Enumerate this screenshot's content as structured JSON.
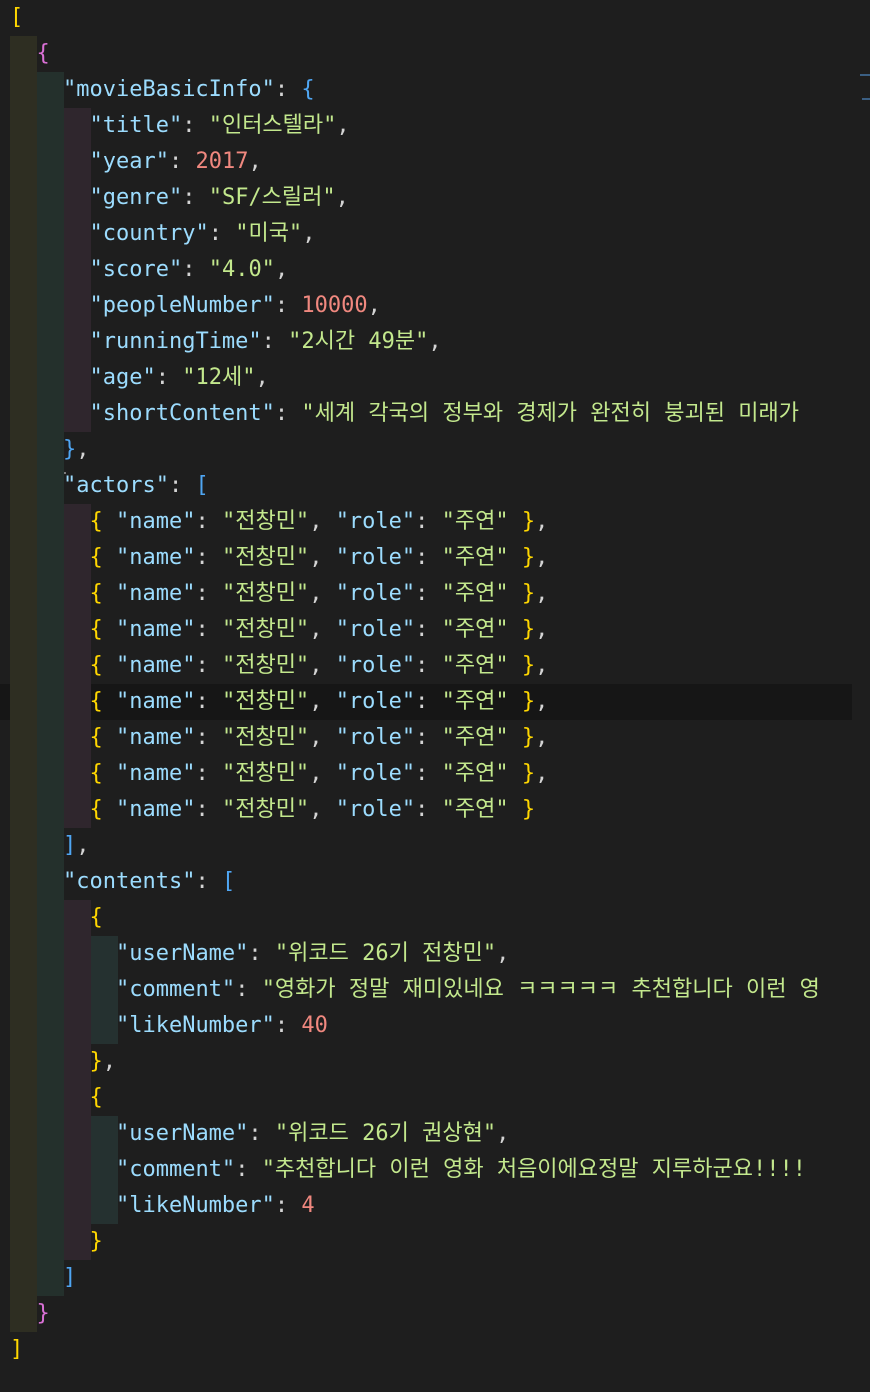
{
  "editor": {
    "language": "json",
    "lines": [
      {
        "tokens": [
          {
            "t": "[",
            "c": "b1"
          }
        ]
      },
      {
        "tokens": [
          {
            "t": "  ",
            "c": "p"
          },
          {
            "t": "{",
            "c": "b2"
          }
        ]
      },
      {
        "tokens": [
          {
            "t": "    ",
            "c": "p"
          },
          {
            "t": "\"movieBasicInfo\"",
            "c": "kk"
          },
          {
            "t": ": ",
            "c": "p"
          },
          {
            "t": "{",
            "c": "b3"
          }
        ]
      },
      {
        "tokens": [
          {
            "t": "      ",
            "c": "p"
          },
          {
            "t": "\"title\"",
            "c": "kk"
          },
          {
            "t": ": ",
            "c": "p"
          },
          {
            "t": "\"인터스텔라\"",
            "c": "ks"
          },
          {
            "t": ",",
            "c": "p"
          }
        ]
      },
      {
        "tokens": [
          {
            "t": "      ",
            "c": "p"
          },
          {
            "t": "\"year\"",
            "c": "kk"
          },
          {
            "t": ": ",
            "c": "p"
          },
          {
            "t": "2017",
            "c": "n"
          },
          {
            "t": ",",
            "c": "p"
          }
        ]
      },
      {
        "tokens": [
          {
            "t": "      ",
            "c": "p"
          },
          {
            "t": "\"genre\"",
            "c": "kk"
          },
          {
            "t": ": ",
            "c": "p"
          },
          {
            "t": "\"SF/스릴러\"",
            "c": "ks"
          },
          {
            "t": ",",
            "c": "p"
          }
        ]
      },
      {
        "tokens": [
          {
            "t": "      ",
            "c": "p"
          },
          {
            "t": "\"country\"",
            "c": "kk"
          },
          {
            "t": ": ",
            "c": "p"
          },
          {
            "t": "\"미국\"",
            "c": "ks"
          },
          {
            "t": ",",
            "c": "p"
          }
        ]
      },
      {
        "tokens": [
          {
            "t": "      ",
            "c": "p"
          },
          {
            "t": "\"score\"",
            "c": "kk"
          },
          {
            "t": ": ",
            "c": "p"
          },
          {
            "t": "\"4.0\"",
            "c": "ks"
          },
          {
            "t": ",",
            "c": "p"
          }
        ]
      },
      {
        "tokens": [
          {
            "t": "      ",
            "c": "p"
          },
          {
            "t": "\"peopleNumber\"",
            "c": "kk"
          },
          {
            "t": ": ",
            "c": "p"
          },
          {
            "t": "10000",
            "c": "n"
          },
          {
            "t": ",",
            "c": "p"
          }
        ]
      },
      {
        "tokens": [
          {
            "t": "      ",
            "c": "p"
          },
          {
            "t": "\"runningTime\"",
            "c": "kk"
          },
          {
            "t": ": ",
            "c": "p"
          },
          {
            "t": "\"2시간 49분\"",
            "c": "ks"
          },
          {
            "t": ",",
            "c": "p"
          }
        ]
      },
      {
        "tokens": [
          {
            "t": "      ",
            "c": "p"
          },
          {
            "t": "\"age\"",
            "c": "kk"
          },
          {
            "t": ": ",
            "c": "p"
          },
          {
            "t": "\"12세\"",
            "c": "ks"
          },
          {
            "t": ",",
            "c": "p"
          }
        ]
      },
      {
        "tokens": [
          {
            "t": "      ",
            "c": "p"
          },
          {
            "t": "\"shortContent\"",
            "c": "kk"
          },
          {
            "t": ": ",
            "c": "p"
          },
          {
            "t": "\"세계 각국의 정부와 경제가 완전히 붕괴된 미래가",
            "c": "ks"
          }
        ]
      },
      {
        "tokens": [
          {
            "t": "    ",
            "c": "p"
          },
          {
            "t": "}",
            "c": "b3"
          },
          {
            "t": ",",
            "c": "p"
          }
        ]
      },
      {
        "tokens": [
          {
            "t": "    ",
            "c": "p"
          },
          {
            "t": "\"actors\"",
            "c": "kk"
          },
          {
            "t": ": ",
            "c": "p"
          },
          {
            "t": "[",
            "c": "b3"
          }
        ]
      },
      {
        "tokens": [
          {
            "t": "      ",
            "c": "p"
          },
          {
            "t": "{",
            "c": "b1"
          },
          {
            "t": " ",
            "c": "p"
          },
          {
            "t": "\"name\"",
            "c": "kk"
          },
          {
            "t": ": ",
            "c": "p"
          },
          {
            "t": "\"전창민\"",
            "c": "ks"
          },
          {
            "t": ", ",
            "c": "p"
          },
          {
            "t": "\"role\"",
            "c": "kk"
          },
          {
            "t": ": ",
            "c": "p"
          },
          {
            "t": "\"주연\"",
            "c": "ks"
          },
          {
            "t": " ",
            "c": "p"
          },
          {
            "t": "}",
            "c": "b1"
          },
          {
            "t": ",",
            "c": "p"
          }
        ]
      },
      {
        "tokens": [
          {
            "t": "      ",
            "c": "p"
          },
          {
            "t": "{",
            "c": "b1"
          },
          {
            "t": " ",
            "c": "p"
          },
          {
            "t": "\"name\"",
            "c": "kk"
          },
          {
            "t": ": ",
            "c": "p"
          },
          {
            "t": "\"전창민\"",
            "c": "ks"
          },
          {
            "t": ", ",
            "c": "p"
          },
          {
            "t": "\"role\"",
            "c": "kk"
          },
          {
            "t": ": ",
            "c": "p"
          },
          {
            "t": "\"주연\"",
            "c": "ks"
          },
          {
            "t": " ",
            "c": "p"
          },
          {
            "t": "}",
            "c": "b1"
          },
          {
            "t": ",",
            "c": "p"
          }
        ]
      },
      {
        "tokens": [
          {
            "t": "      ",
            "c": "p"
          },
          {
            "t": "{",
            "c": "b1"
          },
          {
            "t": " ",
            "c": "p"
          },
          {
            "t": "\"name\"",
            "c": "kk"
          },
          {
            "t": ": ",
            "c": "p"
          },
          {
            "t": "\"전창민\"",
            "c": "ks"
          },
          {
            "t": ", ",
            "c": "p"
          },
          {
            "t": "\"role\"",
            "c": "kk"
          },
          {
            "t": ": ",
            "c": "p"
          },
          {
            "t": "\"주연\"",
            "c": "ks"
          },
          {
            "t": " ",
            "c": "p"
          },
          {
            "t": "}",
            "c": "b1"
          },
          {
            "t": ",",
            "c": "p"
          }
        ]
      },
      {
        "tokens": [
          {
            "t": "      ",
            "c": "p"
          },
          {
            "t": "{",
            "c": "b1"
          },
          {
            "t": " ",
            "c": "p"
          },
          {
            "t": "\"name\"",
            "c": "kk"
          },
          {
            "t": ": ",
            "c": "p"
          },
          {
            "t": "\"전창민\"",
            "c": "ks"
          },
          {
            "t": ", ",
            "c": "p"
          },
          {
            "t": "\"role\"",
            "c": "kk"
          },
          {
            "t": ": ",
            "c": "p"
          },
          {
            "t": "\"주연\"",
            "c": "ks"
          },
          {
            "t": " ",
            "c": "p"
          },
          {
            "t": "}",
            "c": "b1"
          },
          {
            "t": ",",
            "c": "p"
          }
        ]
      },
      {
        "tokens": [
          {
            "t": "      ",
            "c": "p"
          },
          {
            "t": "{",
            "c": "b1"
          },
          {
            "t": " ",
            "c": "p"
          },
          {
            "t": "\"name\"",
            "c": "kk"
          },
          {
            "t": ": ",
            "c": "p"
          },
          {
            "t": "\"전창민\"",
            "c": "ks"
          },
          {
            "t": ", ",
            "c": "p"
          },
          {
            "t": "\"role\"",
            "c": "kk"
          },
          {
            "t": ": ",
            "c": "p"
          },
          {
            "t": "\"주연\"",
            "c": "ks"
          },
          {
            "t": " ",
            "c": "p"
          },
          {
            "t": "}",
            "c": "b1"
          },
          {
            "t": ",",
            "c": "p"
          }
        ]
      },
      {
        "tokens": [
          {
            "t": "      ",
            "c": "p"
          },
          {
            "t": "{",
            "c": "b1"
          },
          {
            "t": " ",
            "c": "p"
          },
          {
            "t": "\"name\"",
            "c": "kk"
          },
          {
            "t": ": ",
            "c": "p"
          },
          {
            "t": "\"전창민\"",
            "c": "ks"
          },
          {
            "t": ", ",
            "c": "p"
          },
          {
            "t": "\"role\"",
            "c": "kk"
          },
          {
            "t": ": ",
            "c": "p"
          },
          {
            "t": "\"주연\"",
            "c": "ks"
          },
          {
            "t": " ",
            "c": "p"
          },
          {
            "t": "}",
            "c": "b1"
          },
          {
            "t": ",",
            "c": "p"
          }
        ]
      },
      {
        "tokens": [
          {
            "t": "      ",
            "c": "p"
          },
          {
            "t": "{",
            "c": "b1"
          },
          {
            "t": " ",
            "c": "p"
          },
          {
            "t": "\"name\"",
            "c": "kk"
          },
          {
            "t": ": ",
            "c": "p"
          },
          {
            "t": "\"전창민\"",
            "c": "ks"
          },
          {
            "t": ", ",
            "c": "p"
          },
          {
            "t": "\"role\"",
            "c": "kk"
          },
          {
            "t": ": ",
            "c": "p"
          },
          {
            "t": "\"주연\"",
            "c": "ks"
          },
          {
            "t": " ",
            "c": "p"
          },
          {
            "t": "}",
            "c": "b1"
          },
          {
            "t": ",",
            "c": "p"
          }
        ]
      },
      {
        "tokens": [
          {
            "t": "      ",
            "c": "p"
          },
          {
            "t": "{",
            "c": "b1"
          },
          {
            "t": " ",
            "c": "p"
          },
          {
            "t": "\"name\"",
            "c": "kk"
          },
          {
            "t": ": ",
            "c": "p"
          },
          {
            "t": "\"전창민\"",
            "c": "ks"
          },
          {
            "t": ", ",
            "c": "p"
          },
          {
            "t": "\"role\"",
            "c": "kk"
          },
          {
            "t": ": ",
            "c": "p"
          },
          {
            "t": "\"주연\"",
            "c": "ks"
          },
          {
            "t": " ",
            "c": "p"
          },
          {
            "t": "}",
            "c": "b1"
          },
          {
            "t": ",",
            "c": "p"
          }
        ]
      },
      {
        "tokens": [
          {
            "t": "      ",
            "c": "p"
          },
          {
            "t": "{",
            "c": "b1"
          },
          {
            "t": " ",
            "c": "p"
          },
          {
            "t": "\"name\"",
            "c": "kk"
          },
          {
            "t": ": ",
            "c": "p"
          },
          {
            "t": "\"전창민\"",
            "c": "ks"
          },
          {
            "t": ", ",
            "c": "p"
          },
          {
            "t": "\"role\"",
            "c": "kk"
          },
          {
            "t": ": ",
            "c": "p"
          },
          {
            "t": "\"주연\"",
            "c": "ks"
          },
          {
            "t": " ",
            "c": "p"
          },
          {
            "t": "}",
            "c": "b1"
          }
        ]
      },
      {
        "tokens": [
          {
            "t": "    ",
            "c": "p"
          },
          {
            "t": "]",
            "c": "b3"
          },
          {
            "t": ",",
            "c": "p"
          }
        ]
      },
      {
        "tokens": [
          {
            "t": "    ",
            "c": "p"
          },
          {
            "t": "\"contents\"",
            "c": "kk"
          },
          {
            "t": ": ",
            "c": "p"
          },
          {
            "t": "[",
            "c": "b3"
          }
        ]
      },
      {
        "tokens": [
          {
            "t": "      ",
            "c": "p"
          },
          {
            "t": "{",
            "c": "b1"
          }
        ]
      },
      {
        "tokens": [
          {
            "t": "        ",
            "c": "p"
          },
          {
            "t": "\"userName\"",
            "c": "kk"
          },
          {
            "t": ": ",
            "c": "p"
          },
          {
            "t": "\"위코드 26기 전창민\"",
            "c": "ks"
          },
          {
            "t": ",",
            "c": "p"
          }
        ]
      },
      {
        "tokens": [
          {
            "t": "        ",
            "c": "p"
          },
          {
            "t": "\"comment\"",
            "c": "kk"
          },
          {
            "t": ": ",
            "c": "p"
          },
          {
            "t": "\"영화가 정말 재미있네요 ㅋㅋㅋㅋㅋ 추천합니다 이런 영",
            "c": "ks"
          }
        ]
      },
      {
        "tokens": [
          {
            "t": "        ",
            "c": "p"
          },
          {
            "t": "\"likeNumber\"",
            "c": "kk"
          },
          {
            "t": ": ",
            "c": "p"
          },
          {
            "t": "40",
            "c": "n"
          }
        ]
      },
      {
        "tokens": [
          {
            "t": "      ",
            "c": "p"
          },
          {
            "t": "}",
            "c": "b1"
          },
          {
            "t": ",",
            "c": "p"
          }
        ]
      },
      {
        "tokens": [
          {
            "t": "      ",
            "c": "p"
          },
          {
            "t": "{",
            "c": "b1"
          }
        ]
      },
      {
        "tokens": [
          {
            "t": "        ",
            "c": "p"
          },
          {
            "t": "\"userName\"",
            "c": "kk"
          },
          {
            "t": ": ",
            "c": "p"
          },
          {
            "t": "\"위코드 26기 권상현\"",
            "c": "ks"
          },
          {
            "t": ",",
            "c": "p"
          }
        ]
      },
      {
        "tokens": [
          {
            "t": "        ",
            "c": "p"
          },
          {
            "t": "\"comment\"",
            "c": "kk"
          },
          {
            "t": ": ",
            "c": "p"
          },
          {
            "t": "\"추천합니다 이런 영화 처음이에요정말 지루하군요!!!!",
            "c": "ks"
          }
        ]
      },
      {
        "tokens": [
          {
            "t": "        ",
            "c": "p"
          },
          {
            "t": "\"likeNumber\"",
            "c": "kk"
          },
          {
            "t": ": ",
            "c": "p"
          },
          {
            "t": "4",
            "c": "n"
          }
        ]
      },
      {
        "tokens": [
          {
            "t": "      ",
            "c": "p"
          },
          {
            "t": "}",
            "c": "b1"
          }
        ]
      },
      {
        "tokens": [
          {
            "t": "    ",
            "c": "p"
          },
          {
            "t": "]",
            "c": "b3"
          }
        ]
      },
      {
        "tokens": [
          {
            "t": "  ",
            "c": "p"
          },
          {
            "t": "}",
            "c": "b2"
          }
        ]
      },
      {
        "tokens": [
          {
            "t": "]",
            "c": "b1"
          }
        ]
      }
    ]
  },
  "colors": {
    "background": "#1e1e1e",
    "key": "#9cdcfe",
    "string": "#c3e88d",
    "number": "#f0887f",
    "bracket_level1": "#ffd700",
    "bracket_level2": "#da70d6",
    "bracket_level3": "#4fa6f3",
    "current_line": "#161616"
  }
}
